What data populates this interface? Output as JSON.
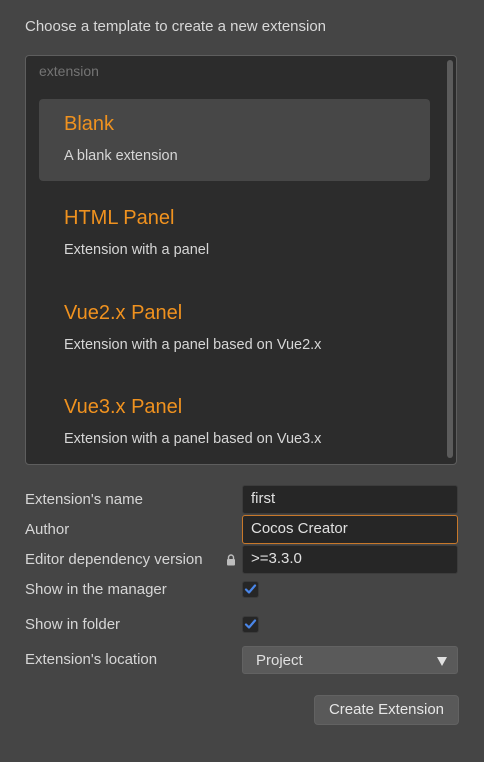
{
  "dialog": {
    "heading": "Choose a template to create a new extension"
  },
  "template_list": {
    "group_label": "extension",
    "items": [
      {
        "title": "Blank",
        "description": "A blank extension",
        "selected": true
      },
      {
        "title": "HTML Panel",
        "description": "Extension with a panel",
        "selected": false
      },
      {
        "title": "Vue2.x Panel",
        "description": "Extension with a panel based on Vue2.x",
        "selected": false
      },
      {
        "title": "Vue3.x Panel",
        "description": "Extension with a panel based on Vue3.x",
        "selected": false
      }
    ]
  },
  "form": {
    "name": {
      "label": "Extension's name",
      "value": "first"
    },
    "author": {
      "label": "Author",
      "value": "Cocos Creator"
    },
    "editor_dependency": {
      "label": "Editor dependency version",
      "value": ">=3.3.0",
      "icon": "lock-icon"
    },
    "show_in_manager": {
      "label": "Show in the manager",
      "checked": true
    },
    "show_in_folder": {
      "label": "Show in folder",
      "checked": true
    },
    "location": {
      "label": "Extension's location",
      "selected": "Project"
    }
  },
  "actions": {
    "create_label": "Create Extension"
  },
  "colors": {
    "accent": "#f0921f",
    "checkmark": "#4a86e8",
    "focus_border": "#c8782a"
  }
}
